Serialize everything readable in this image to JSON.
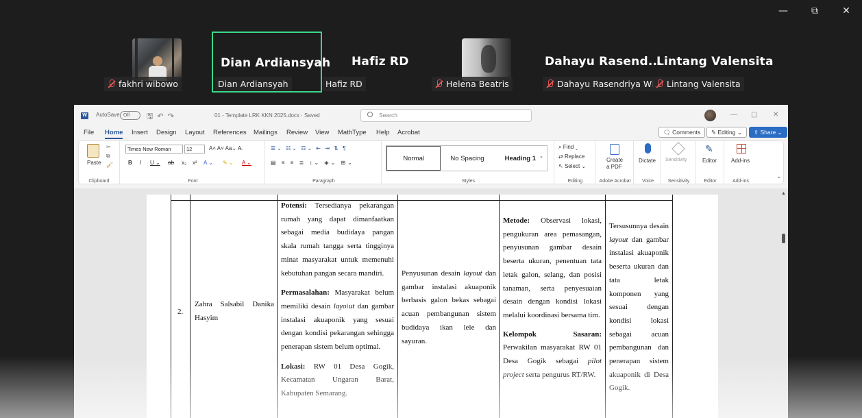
{
  "window_controls": {
    "minimize": "—",
    "restore": "⧉",
    "close": "✕"
  },
  "participants": [
    {
      "display": "",
      "tag": "fakhri wibowo",
      "muted": true
    },
    {
      "display": "Dian Ardiansyah",
      "tag": "Dian Ardiansyah",
      "muted": false,
      "active": true
    },
    {
      "display": "Hafiz RD",
      "tag": "Hafiz RD",
      "muted": false
    },
    {
      "display": "",
      "tag": "Helena Beatris",
      "muted": true
    },
    {
      "display": "Dahayu  Rasend...",
      "tag": "Dahayu Rasendriya Wi...",
      "muted": true
    },
    {
      "display": "Lintang Valensita",
      "tag": "Lintang Valensita",
      "muted": true
    }
  ],
  "word": {
    "autosave_label": "AutoSave",
    "autosave_state": "Off",
    "doc_title": "01 - Template LRK KKN 2025.docx  ·  Saved",
    "search_placeholder": "Search",
    "menu": [
      "File",
      "Home",
      "Insert",
      "Design",
      "Layout",
      "References",
      "Mailings",
      "Review",
      "View",
      "MathType",
      "Help",
      "Acrobat"
    ],
    "comments_btn": "Comments",
    "editing_btn": "Editing",
    "share_btn": "Share",
    "clipboard": {
      "paste": "Paste",
      "label": "Clipboard"
    },
    "font": {
      "name": "Times New Roman",
      "size": "12",
      "label": "Font"
    },
    "paragraph_label": "Paragraph",
    "styles": {
      "items": [
        "Normal",
        "No Spacing",
        "Heading 1"
      ],
      "label": "Styles"
    },
    "editing": {
      "find": "Find",
      "replace": "Replace",
      "select": "Select",
      "label": "Editing"
    },
    "acrobat": {
      "create": "Create",
      "pdf": "a PDF",
      "label": "Adobe Acrobat"
    },
    "voice": {
      "dictate": "Dictate",
      "label": "Voice"
    },
    "sensitivity": {
      "btn": "Sensitivity",
      "label": "Sensitivity"
    },
    "editor": {
      "btn": "Editor",
      "label": "Editor"
    },
    "addins": {
      "btn": "Add-ins",
      "label": "Add-ins"
    }
  },
  "table_row": {
    "number": "2.",
    "name": "Zahra Salsabil Danika Hasyim",
    "potensi_label": "Potensi:",
    "potensi_text": "Tersedianya pekarangan rumah yang dapat dimanfaatkan sebagai media budidaya pangan skala rumah tangga serta tingginya minat masyarakat untuk memenuhi kebutuhan pangan secara mandiri.",
    "permasalahan_label": "Permasalahan:",
    "permasalahan_text_1": "Masyarakat belum memiliki desain",
    "permasalahan_italic": "layo\\ut",
    "permasalahan_text_2": "dan gambar instalasi akuaponik yang sesuai dengan kondisi pekarangan sehingga penerapan sistem belum optimal.",
    "lokasi_label": "Lokasi:",
    "lokasi_text": "RW 01 Desa Gogik, Kecamatan Ungaran Barat, Kabupaten Semarang.",
    "program_1": "Penyusunan desain",
    "program_italic": "layout",
    "program_2": "dan gambar instalasi akuaponik berbasis galon bekas sebagai acuan pembangunan sistem budidaya ikan lele dan sayuran.",
    "metode_label": "Metode:",
    "metode_text": "Observasi lokasi, pengukuran area pemasangan, penyusunan gambar desain beserta ukuran, penentuan tata letak galon, selang, dan posisi tanaman, serta penyesuaian desain dengan kondisi lokasi melalui koordinasi bersama tim.",
    "sasaran_label_1": "Kelompok",
    "sasaran_label_2": "Sasaran:",
    "sasaran_text_1": "Perwakilan masyarakat RW 01 Desa Gogik sebagai",
    "sasaran_italic": "pilot project",
    "sasaran_text_2": "serta pengurus RT/RW.",
    "hasil_1": "Tersusunnya desain",
    "hasil_italic": "layout",
    "hasil_2": "dan gambar instalasi akuaponik beserta ukuran dan tata letak komponen yang sesuai dengan kondisi lokasi sebagai acuan pembangunan dan penerapan sistem akuaponik di Desa Gogik."
  }
}
